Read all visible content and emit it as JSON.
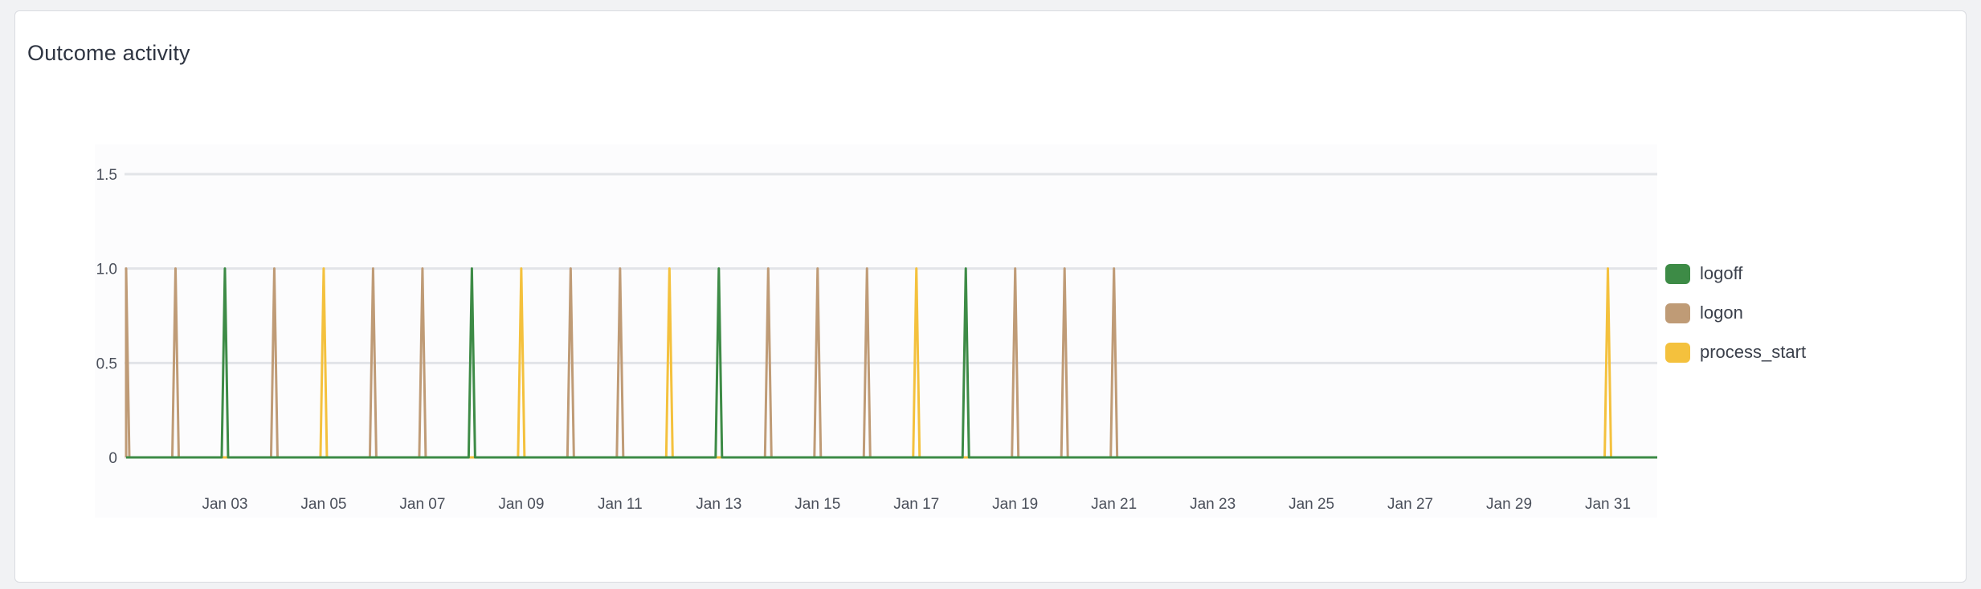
{
  "card": {
    "title": "Outcome activity"
  },
  "chart_data": {
    "type": "line",
    "title": "Outcome activity",
    "xlabel": "",
    "ylabel": "",
    "x_range": [
      "2024-01-01",
      "2024-02-01"
    ],
    "ylim": [
      0,
      1.5
    ],
    "y_ticks": [
      0,
      0.5,
      1.0,
      1.5
    ],
    "y_tick_labels": [
      "0",
      "0.5",
      "1.0",
      "1.5"
    ],
    "x_tick_dates": [
      "2024-01-03",
      "2024-01-05",
      "2024-01-07",
      "2024-01-09",
      "2024-01-11",
      "2024-01-13",
      "2024-01-15",
      "2024-01-17",
      "2024-01-19",
      "2024-01-21",
      "2024-01-23",
      "2024-01-25",
      "2024-01-27",
      "2024-01-29",
      "2024-01-31"
    ],
    "x_tick_labels": [
      "Jan 03",
      "Jan 05",
      "Jan 07",
      "Jan 09",
      "Jan 11",
      "Jan 13",
      "Jan 15",
      "Jan 17",
      "Jan 19",
      "Jan 21",
      "Jan 23",
      "Jan 25",
      "Jan 27",
      "Jan 29",
      "Jan 31"
    ],
    "grid": true,
    "legend_position": "right",
    "series": [
      {
        "name": "logoff",
        "color": "#3d8b46",
        "events": [
          {
            "date": "2024-01-03",
            "value": 1
          },
          {
            "date": "2024-01-08",
            "value": 1
          },
          {
            "date": "2024-01-13",
            "value": 1
          },
          {
            "date": "2024-01-18",
            "value": 1
          }
        ]
      },
      {
        "name": "logon",
        "color": "#bf9b76",
        "events": [
          {
            "date": "2024-01-01",
            "value": 1
          },
          {
            "date": "2024-01-02",
            "value": 1
          },
          {
            "date": "2024-01-04",
            "value": 1
          },
          {
            "date": "2024-01-06",
            "value": 1
          },
          {
            "date": "2024-01-07",
            "value": 1
          },
          {
            "date": "2024-01-10",
            "value": 1
          },
          {
            "date": "2024-01-11",
            "value": 1
          },
          {
            "date": "2024-01-14",
            "value": 1
          },
          {
            "date": "2024-01-15",
            "value": 1
          },
          {
            "date": "2024-01-16",
            "value": 1
          },
          {
            "date": "2024-01-19",
            "value": 1
          },
          {
            "date": "2024-01-20",
            "value": 1
          },
          {
            "date": "2024-01-21",
            "value": 1
          }
        ]
      },
      {
        "name": "process_start",
        "color": "#f4c13d",
        "events": [
          {
            "date": "2024-01-05",
            "value": 1
          },
          {
            "date": "2024-01-09",
            "value": 1
          },
          {
            "date": "2024-01-12",
            "value": 1
          },
          {
            "date": "2024-01-17",
            "value": 1
          },
          {
            "date": "2024-01-31",
            "value": 1
          }
        ]
      }
    ]
  }
}
